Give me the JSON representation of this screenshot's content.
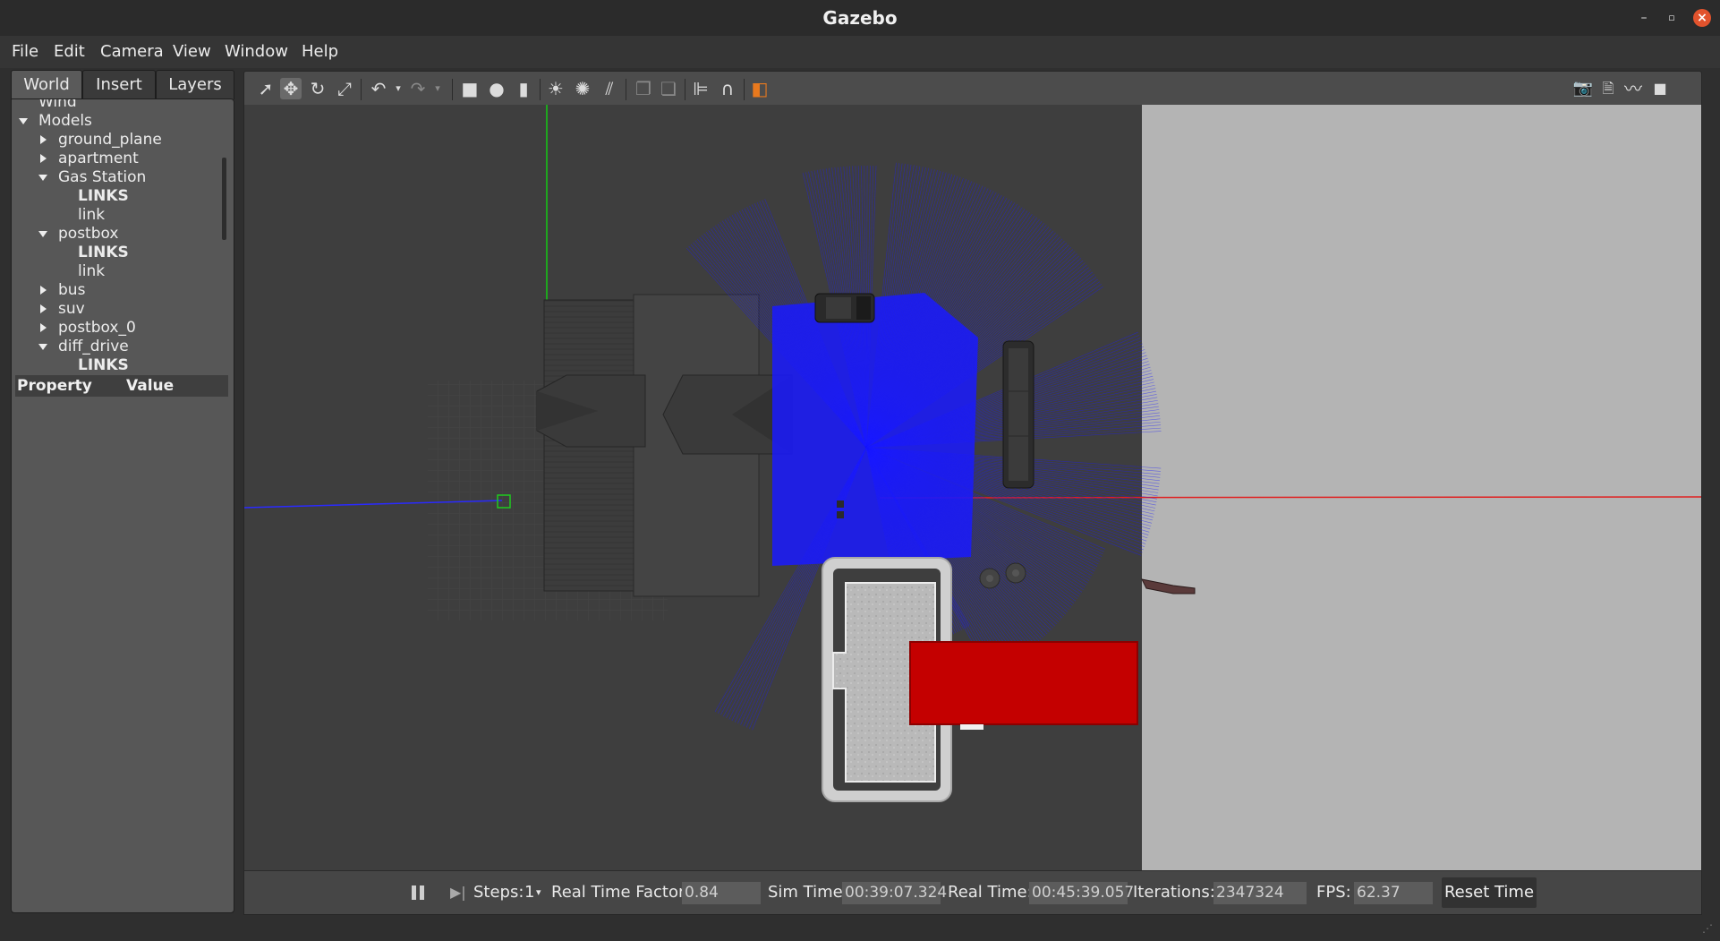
{
  "window": {
    "title": "Gazebo"
  },
  "menu": [
    "File",
    "Edit",
    "Camera",
    "View",
    "Window",
    "Help"
  ],
  "tabs": {
    "world": "World",
    "insert": "Insert",
    "layers": "Layers"
  },
  "tree": {
    "rows": [
      {
        "label": "Wind",
        "indent": 0,
        "expander": "none",
        "bold": false
      },
      {
        "label": "Models",
        "indent": 0,
        "expander": "down",
        "bold": false
      },
      {
        "label": "ground_plane",
        "indent": 1,
        "expander": "right",
        "bold": false
      },
      {
        "label": "apartment",
        "indent": 1,
        "expander": "right",
        "bold": false
      },
      {
        "label": "Gas Station",
        "indent": 1,
        "expander": "down",
        "bold": false
      },
      {
        "label": "LINKS",
        "indent": 2,
        "expander": "none",
        "bold": true
      },
      {
        "label": "link",
        "indent": 2,
        "expander": "none",
        "bold": false
      },
      {
        "label": "postbox",
        "indent": 1,
        "expander": "down",
        "bold": false
      },
      {
        "label": "LINKS",
        "indent": 2,
        "expander": "none",
        "bold": true
      },
      {
        "label": "link",
        "indent": 2,
        "expander": "none",
        "bold": false
      },
      {
        "label": "bus",
        "indent": 1,
        "expander": "right",
        "bold": false
      },
      {
        "label": "suv",
        "indent": 1,
        "expander": "right",
        "bold": false
      },
      {
        "label": "postbox_0",
        "indent": 1,
        "expander": "right",
        "bold": false
      },
      {
        "label": "diff_drive",
        "indent": 1,
        "expander": "down",
        "bold": false
      },
      {
        "label": "LINKS",
        "indent": 2,
        "expander": "none",
        "bold": true
      }
    ]
  },
  "properties": {
    "col_property": "Property",
    "col_value": "Value"
  },
  "toolbar": {
    "tools": [
      "select-icon",
      "translate-icon",
      "rotate-icon",
      "scale-icon",
      "undo-icon",
      "undo-history-icon",
      "redo-icon",
      "redo-history-icon",
      "box-icon",
      "sphere-icon",
      "cylinder-icon",
      "point-light-icon",
      "spot-light-icon",
      "directional-light-icon",
      "copy-icon",
      "paste-icon",
      "align-icon",
      "magnet-icon",
      "change-view-icon"
    ],
    "right_tools": [
      "screenshot-icon",
      "log-icon",
      "plot-icon",
      "record-video-icon"
    ]
  },
  "status": {
    "steps_label": "Steps:",
    "steps_value": "1",
    "rtf_label": "Real Time Factor:",
    "rtf_value": "0.84",
    "sim_time_label": "Sim Time:",
    "sim_time_value": "00:39:07.324",
    "real_time_label": "Real Time:",
    "real_time_value": "00:45:39.057",
    "iterations_label": "Iterations:",
    "iterations_value": "2347324",
    "fps_label": "FPS:",
    "fps_value": "62.37",
    "reset_label": "Reset Time"
  },
  "colors": {
    "laser": "#1a1aff",
    "fire_truck": "#c40000",
    "floor_light": "#b4b4b4",
    "floor_dark": "#3e3e3e"
  }
}
